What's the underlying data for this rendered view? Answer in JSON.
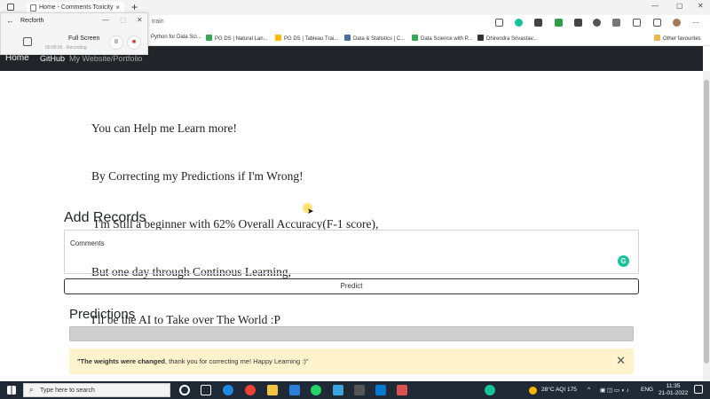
{
  "browser": {
    "tab_title": "Home - Comments Toxicity",
    "tab_close": "×",
    "new_tab": "+",
    "window_min": "—",
    "window_max": "▢",
    "window_close": "✕",
    "address_partial": "train",
    "bookmarks": [
      "Python for Data Sci...",
      "PG DS | Natural Lan...",
      "PG DS | Tableau Trai...",
      "Data & Statistics | C...",
      "Data Science with P...",
      "Dhirendra Srivastav...",
      "Other favourites"
    ]
  },
  "recorder": {
    "title": "Recforth",
    "back": "←",
    "minimize": "—",
    "maximize": "▢",
    "close": "✕",
    "mode": "Full Screen",
    "status": "00:00:00 · Recording",
    "pause": "II",
    "stop": "■"
  },
  "site_nav": {
    "home": "Home",
    "github": "GitHub",
    "portfolio": "My Website/Portfolio"
  },
  "intro": {
    "line1": "You can Help me Learn more!",
    "line2": "By Correcting my Predictions if I'm Wrong!",
    "line3": " I'm Still a beginner with 62% Overall Accuracy(F-1 score),",
    "line4": "But one day through Continous Learning,",
    "line5": "I'll be the AI to Take over The World :P"
  },
  "form": {
    "heading": "Add Records",
    "comments_placeholder": "Comments",
    "grammarly": "G",
    "predict_label": "Predict"
  },
  "predictions": {
    "heading": "Predictions",
    "alert_bold": "\"The weights were changed",
    "alert_rest": ", thank you for correcting me! Happy Learning :)\"",
    "alert_close": "✕"
  },
  "taskbar": {
    "search_placeholder": "Type here to search",
    "weather": "28°C  AQI 175",
    "language": "ENG",
    "time": "11:35",
    "date": "21-01-2022"
  }
}
